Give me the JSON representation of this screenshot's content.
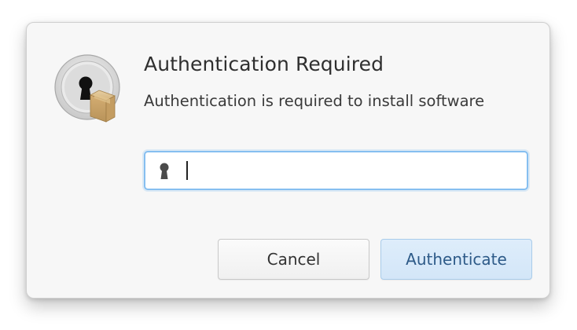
{
  "dialog": {
    "title": "Authentication Required",
    "message": "Authentication is required to install software",
    "icon": "lock-with-package-icon",
    "password": {
      "value": "",
      "placeholder": "",
      "icon": "key-icon"
    },
    "buttons": {
      "cancel_label": "Cancel",
      "authenticate_label": "Authenticate"
    },
    "colors": {
      "focus_border": "#86bff0",
      "suggested_button_bg": "#d8e9fa",
      "suggested_button_text": "#2d5a88",
      "dialog_bg": "#f7f7f7"
    }
  }
}
